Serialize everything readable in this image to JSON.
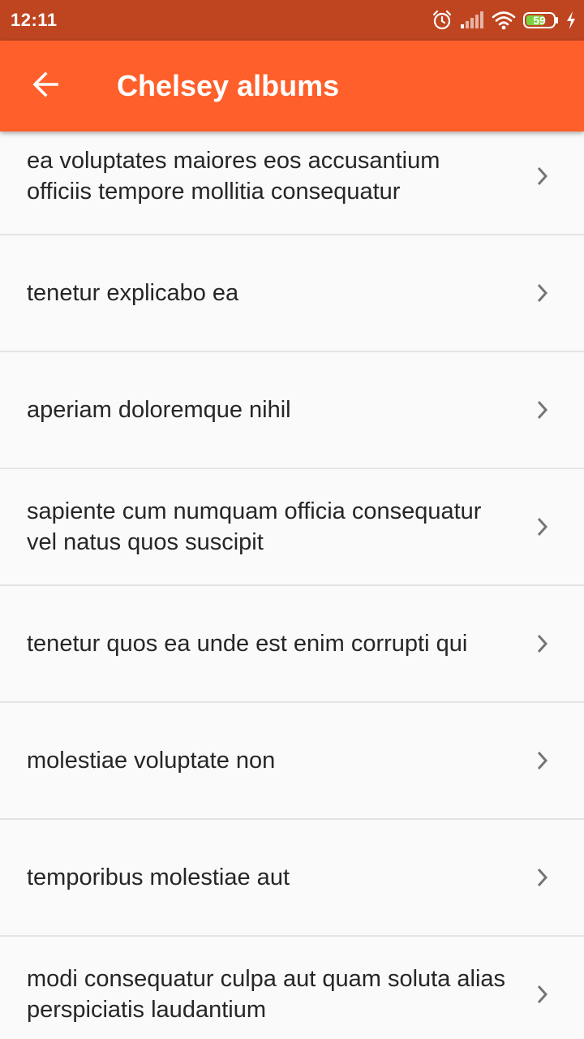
{
  "status_bar": {
    "time": "12:11",
    "battery": "59",
    "icons": [
      "alarm-icon",
      "signal-icon",
      "wifi-icon",
      "battery-icon",
      "charging-icon"
    ]
  },
  "app_bar": {
    "title": "Chelsey albums",
    "back_icon": "arrow-back-icon",
    "color": "#ff5f2a"
  },
  "colors": {
    "status_bar": "#bf4520",
    "app_bar": "#ff5f2a",
    "background": "#fafafa",
    "text": "#262626",
    "chevron": "#757575"
  },
  "albums": [
    {
      "title": "ea voluptates maiores eos accusantium officiis tempore mollitia consequatur"
    },
    {
      "title": "tenetur explicabo ea"
    },
    {
      "title": "aperiam doloremque nihil"
    },
    {
      "title": "sapiente cum numquam officia consequatur vel natus quos suscipit"
    },
    {
      "title": "tenetur quos ea unde est enim corrupti qui"
    },
    {
      "title": "molestiae voluptate non"
    },
    {
      "title": "temporibus molestiae aut"
    },
    {
      "title": "modi consequatur culpa aut quam soluta alias perspiciatis laudantium"
    }
  ]
}
